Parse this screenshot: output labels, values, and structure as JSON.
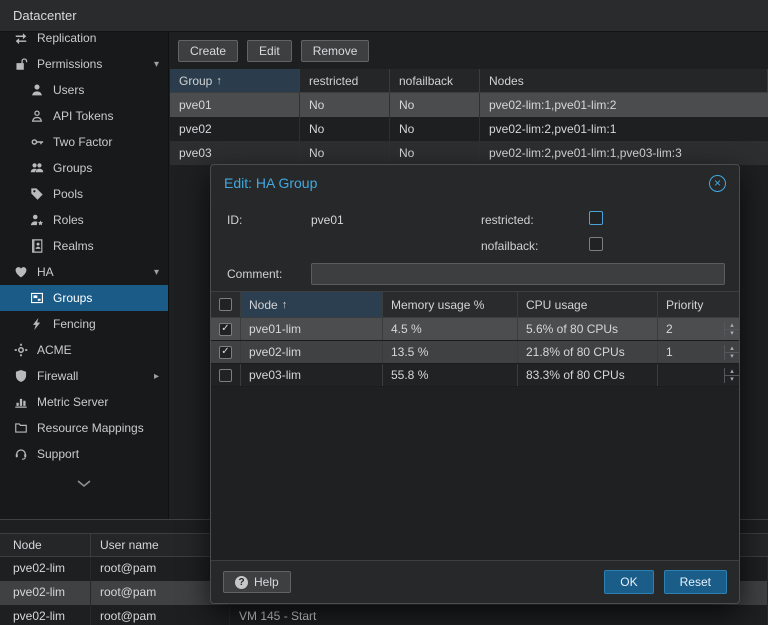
{
  "topbar": {
    "title": "Datacenter"
  },
  "sidebar": {
    "items": [
      {
        "label": "Replication",
        "icon": "replication-icon"
      },
      {
        "label": "Permissions",
        "icon": "unlock-icon",
        "expanded": true
      },
      {
        "label": "Users",
        "icon": "user-icon"
      },
      {
        "label": "API Tokens",
        "icon": "user-outline-icon"
      },
      {
        "label": "Two Factor",
        "icon": "key-icon"
      },
      {
        "label": "Groups",
        "icon": "users-icon"
      },
      {
        "label": "Pools",
        "icon": "tag-icon"
      },
      {
        "label": "Roles",
        "icon": "user-badge-icon"
      },
      {
        "label": "Realms",
        "icon": "address-book-icon"
      },
      {
        "label": "HA",
        "icon": "heart-icon",
        "expanded": true
      },
      {
        "label": "Groups",
        "icon": "object-group-icon",
        "selected": true
      },
      {
        "label": "Fencing",
        "icon": "bolt-icon"
      },
      {
        "label": "ACME",
        "icon": "gear-icon"
      },
      {
        "label": "Firewall",
        "icon": "shield-icon",
        "collapsed": true
      },
      {
        "label": "Metric Server",
        "icon": "bar-chart-icon"
      },
      {
        "label": "Resource Mappings",
        "icon": "folder-icon"
      },
      {
        "label": "Support",
        "icon": "headset-icon"
      }
    ],
    "expander_down": "▾",
    "expander_right": "▸"
  },
  "toolbar": {
    "create": "Create",
    "edit": "Edit",
    "remove": "Remove"
  },
  "groups_table": {
    "headers": {
      "group": "Group",
      "restricted": "restricted",
      "nofailback": "nofailback",
      "nodes": "Nodes"
    },
    "sort_arrow": "↑",
    "rows": [
      {
        "group": "pve01",
        "restricted": "No",
        "nofailback": "No",
        "nodes": "pve02-lim:1,pve01-lim:2",
        "selected": true
      },
      {
        "group": "pve02",
        "restricted": "No",
        "nofailback": "No",
        "nodes": "pve02-lim:2,pve01-lim:1",
        "selected": false
      },
      {
        "group": "pve03",
        "restricted": "No",
        "nofailback": "No",
        "nodes": "pve02-lim:2,pve01-lim:1,pve03-lim:3",
        "selected": false
      }
    ]
  },
  "dialog": {
    "title": "Edit: HA Group",
    "close_glyph": "×",
    "id_label": "ID:",
    "id_value": "pve01",
    "restricted_label": "restricted:",
    "restricted_checked": false,
    "nofailback_label": "nofailback:",
    "nofailback_checked": false,
    "comment_label": "Comment:",
    "comment_value": "",
    "node_table": {
      "headers": {
        "node": "Node",
        "memory": "Memory usage %",
        "cpu": "CPU usage",
        "priority": "Priority"
      },
      "sort_arrow": "↑",
      "rows": [
        {
          "checked": true,
          "node": "pve01-lim",
          "memory": "4.5 %",
          "cpu": "5.6% of 80 CPUs",
          "priority": "2"
        },
        {
          "checked": true,
          "node": "pve02-lim",
          "memory": "13.5 %",
          "cpu": "21.8% of 80 CPUs",
          "priority": "1"
        },
        {
          "checked": false,
          "node": "pve03-lim",
          "memory": "55.8 %",
          "cpu": "83.3% of 80 CPUs",
          "priority": ""
        }
      ]
    },
    "help_label": "Help",
    "ok_label": "OK",
    "reset_label": "Reset"
  },
  "task_log": {
    "headers": {
      "node": "Node",
      "user": "User name"
    },
    "rows": [
      {
        "node": "pve02-lim",
        "user": "root@pam",
        "description": ""
      },
      {
        "node": "pve02-lim",
        "user": "root@pam",
        "description": ""
      },
      {
        "node": "pve02-lim",
        "user": "root@pam",
        "description": "VM 145 - Start"
      }
    ]
  },
  "colors": {
    "selection_blue": "#1a5c87",
    "dialog_title_blue": "#41a8e0",
    "button_blue": "#1a5d89",
    "selected_row_gray": "#4a4c4e"
  }
}
